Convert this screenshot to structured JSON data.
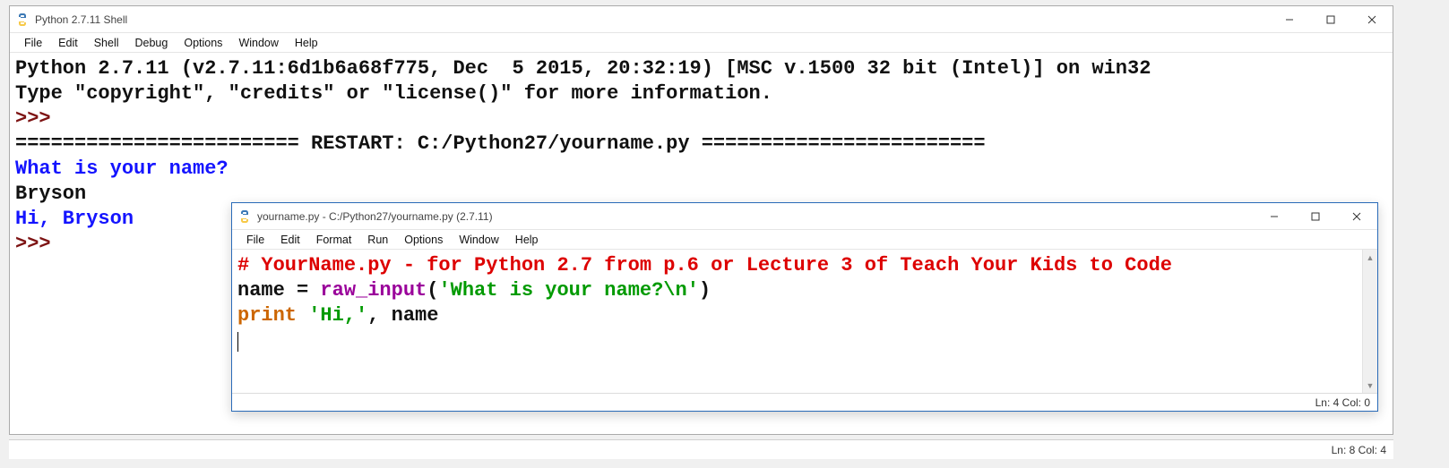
{
  "shell": {
    "title": "Python 2.7.11 Shell",
    "menu": [
      "File",
      "Edit",
      "Shell",
      "Debug",
      "Options",
      "Window",
      "Help"
    ],
    "lines": {
      "l1": "Python 2.7.11 (v2.7.11:6d1b6a68f775, Dec  5 2015, 20:32:19) [MSC v.1500 32 bit (Intel)] on win32",
      "l2": "Type \"copyright\", \"credits\" or \"license()\" for more information.",
      "prompt": ">>> ",
      "restart": "======================== RESTART: C:/Python27/yourname.py ========================",
      "q": "What is your name?",
      "ans": "Bryson",
      "greet": "Hi, Bryson"
    }
  },
  "editor": {
    "title": "yourname.py - C:/Python27/yourname.py (2.7.11)",
    "menu": [
      "File",
      "Edit",
      "Format",
      "Run",
      "Options",
      "Window",
      "Help"
    ],
    "code": {
      "comment": "# YourName.py - for Python 2.7 from p.6 or Lecture 3 of Teach Your Kids to Code",
      "assign_lhs": "name = ",
      "func": "raw_input",
      "paren_open": "(",
      "str": "'What is your name?\\n'",
      "paren_close": ")",
      "print_kw": "print",
      "print_sp": " ",
      "print_str": "'Hi,'",
      "print_rest": ", name"
    },
    "status": "Ln: 4  Col: 0"
  },
  "outer_status": "Ln: 8  Col: 4"
}
